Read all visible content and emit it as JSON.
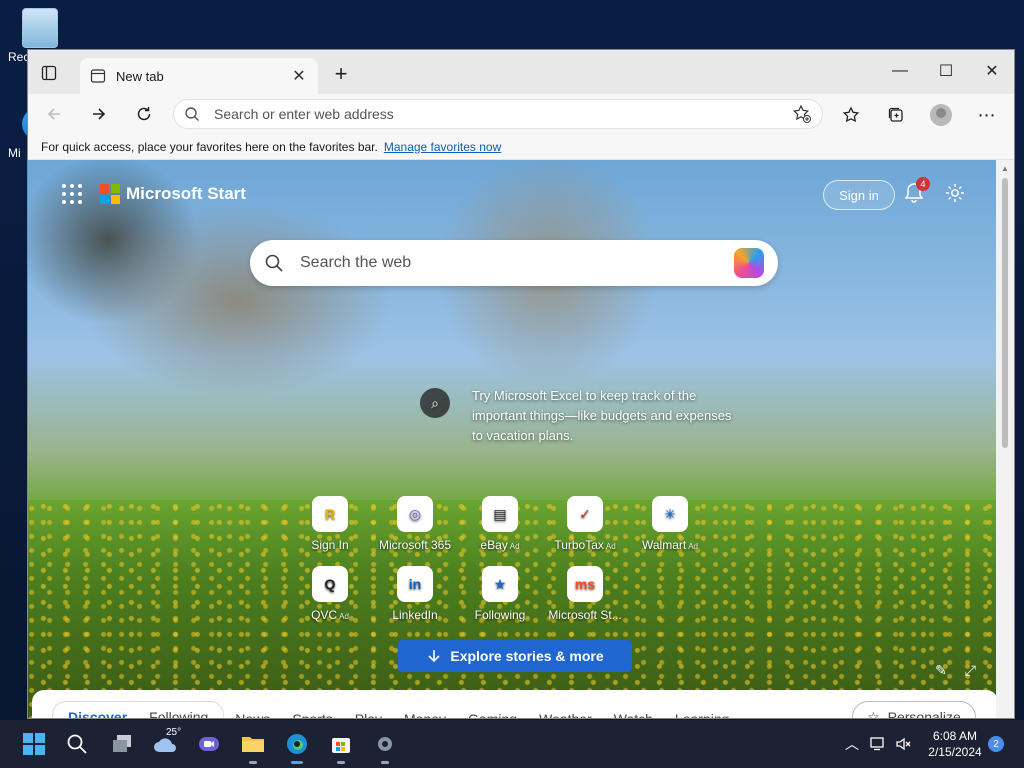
{
  "desktop": {
    "icons": [
      {
        "label": "Rec",
        "icon": "recycle-bin-icon"
      },
      {
        "label": "Mi",
        "icon": "shortcut-icon"
      }
    ]
  },
  "browser": {
    "tab": {
      "title": "New tab",
      "close_label": "✕"
    },
    "new_tab_label": "+",
    "window_controls": {
      "minimize": "—",
      "maximize": "☐",
      "close": "✕"
    },
    "address_bar": {
      "placeholder": "Search or enter web address"
    },
    "favorites_bar": {
      "text": "For quick access, place your favorites here on the favorites bar.",
      "link": "Manage favorites now"
    }
  },
  "ms_start": {
    "title": "Microsoft Start",
    "sign_in": "Sign in",
    "notification_count": "4",
    "search_placeholder": "Search the web",
    "promo_text": "Try Microsoft Excel to keep track of the important things—like budgets and expenses to vacation plans.",
    "sites": [
      {
        "label": "Sign In",
        "ad": "",
        "tile": "R",
        "color": "#e8b400"
      },
      {
        "label": "Microsoft 365",
        "ad": "",
        "tile": "◎",
        "color": "#7a5cf0"
      },
      {
        "label": "eBay",
        "ad": "Ad",
        "tile": "▤",
        "color": "#333333"
      },
      {
        "label": "TurboTax",
        "ad": "Ad",
        "tile": "✓",
        "color": "#d52b1e"
      },
      {
        "label": "Walmart",
        "ad": "Ad",
        "tile": "✳",
        "color": "#0071ce"
      },
      {
        "label": "QVC",
        "ad": "Ad",
        "tile": "Q",
        "color": "#222222"
      },
      {
        "label": "LinkedIn",
        "ad": "",
        "tile": "in",
        "color": "#0a66c2"
      },
      {
        "label": "Following",
        "ad": "",
        "tile": "★",
        "color": "#1f66d1"
      },
      {
        "label": "Microsoft St...",
        "ad": "",
        "tile": "ms",
        "color": "#f25022"
      }
    ],
    "explore_button": "Explore stories & more",
    "feed_tabs": [
      "Discover",
      "Following",
      "News",
      "Sports",
      "Play",
      "Money",
      "Gaming",
      "Weather",
      "Watch",
      "Learning"
    ],
    "more_label": "...",
    "personalize_label": "Personalize"
  },
  "taskbar": {
    "weather_temp": "25°",
    "time": "6:08 AM",
    "date": "2/15/2024",
    "notification_count": "2"
  },
  "colors": {
    "accent": "#1f66d1",
    "taskbar": "#1c2233"
  }
}
